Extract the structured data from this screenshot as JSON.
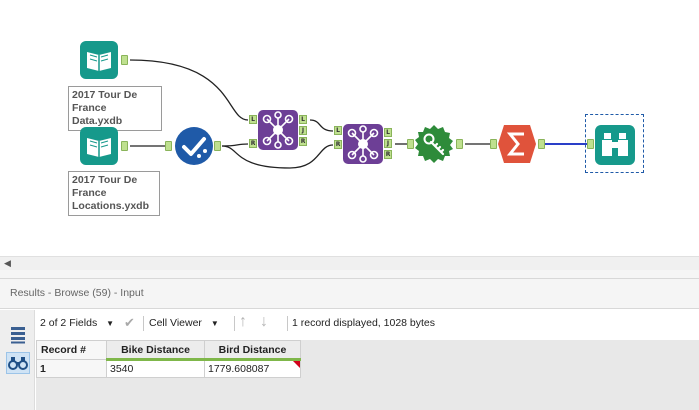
{
  "canvas": {
    "inputs": [
      {
        "label": "2017 Tour De France Data.yxdb"
      },
      {
        "label": "2017 Tour De France Locations.yxdb"
      }
    ],
    "anchor_letters": {
      "left": "L",
      "right": "R",
      "join": "J"
    }
  },
  "results": {
    "title": "Results - Browse (59) - Input"
  },
  "toolbar": {
    "fields_label": "2 of 2 Fields",
    "cell_viewer_label": "Cell Viewer",
    "status": "1 record displayed, 1028 bytes"
  },
  "grid": {
    "record_header": "Record #",
    "columns": [
      "Bike Distance",
      "Bird Distance"
    ],
    "rows": [
      {
        "record": "1",
        "values": [
          "3540",
          "1779.608087"
        ]
      }
    ]
  },
  "colors": {
    "input_tool": "#16998b",
    "join_tool": "#6d3f96",
    "select_tool": "#1f5aa8",
    "formula_tool": "#2e8b3a",
    "summarize_tool": "#e0533b",
    "browse_tool": "#16998b",
    "anchor": "#bfe08f",
    "selected_wire": "#2a3fc8"
  }
}
